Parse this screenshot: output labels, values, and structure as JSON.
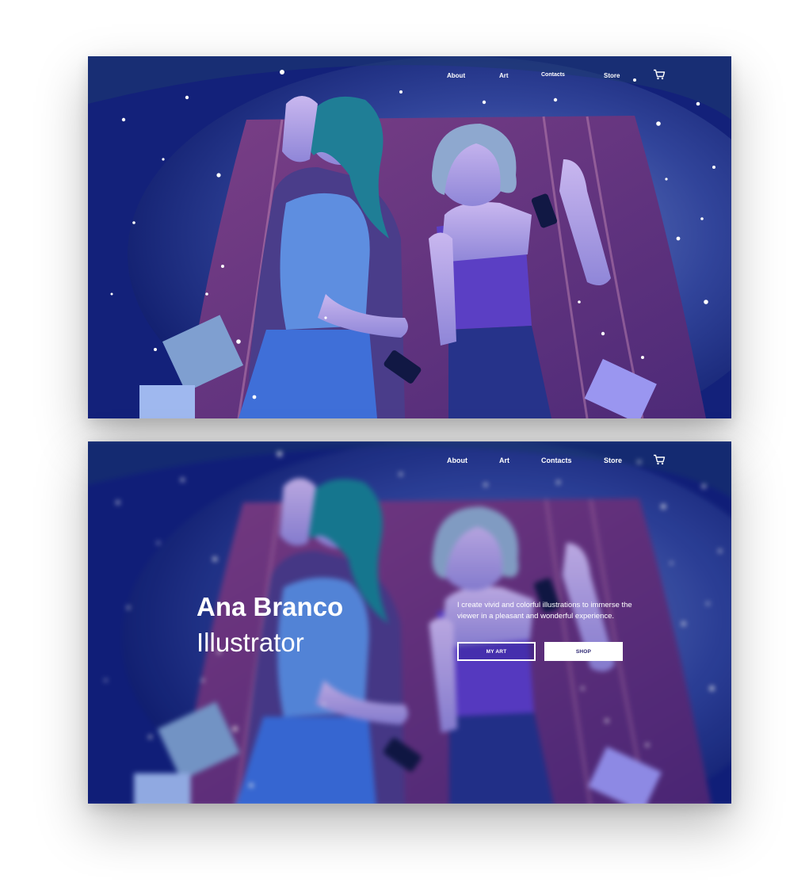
{
  "desktop_preview": {
    "nav": {
      "about": "About",
      "art": "Art",
      "contacts": "Contacts",
      "store": "Store",
      "cart_icon": "shopping-cart-icon"
    }
  },
  "landing": {
    "nav": {
      "about": "About",
      "art": "Art",
      "contacts": "Contacts",
      "store": "Store",
      "cart_icon": "shopping-cart-icon"
    },
    "hero": {
      "name": "Ana Branco",
      "role": "Illustrator",
      "description": "I create vivid and colorful illustrations to immerse the viewer in a pleasant and wonderful experience.",
      "primary_button": "MY ART",
      "secondary_button": "SHOP"
    }
  },
  "colors": {
    "night_sky": "#15237a",
    "blanket": "#6a2f7a",
    "button_text": "#2a2470",
    "white": "#ffffff"
  }
}
